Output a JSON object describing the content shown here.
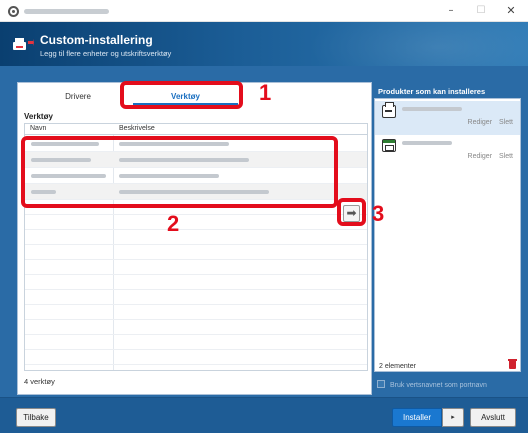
{
  "window": {
    "controls": {
      "minimize": "–",
      "maximize": "☐",
      "close": "✕"
    }
  },
  "header": {
    "title": "Custom-installering",
    "subtitle": "Legg til flere enheter og utskriftsverktøy"
  },
  "tabs": [
    {
      "label": "Drivere",
      "active": false
    },
    {
      "label": "Verktøy",
      "active": true
    }
  ],
  "tools": {
    "section_label": "Verktøy",
    "columns": [
      "Navn",
      "Beskrivelse"
    ],
    "row_count": 4,
    "count_text": "4 verktøy"
  },
  "move_button": {
    "icon": "arrow-right-icon",
    "glyph": "➡"
  },
  "products": {
    "title": "Produkter som kan installeres",
    "items": [
      {
        "icon": "printer-icon",
        "edit": "Rediger",
        "delete": "Slett",
        "selected": true
      },
      {
        "icon": "window-icon",
        "edit": "Rediger",
        "delete": "Slett",
        "selected": false
      }
    ],
    "count_text": "2 elementer"
  },
  "use_hostname_label": "Bruk vertsnavnet som portnavn",
  "footer": {
    "back": "Tilbake",
    "install": "Installer",
    "split_arrow": "▸",
    "close": "Avslutt"
  },
  "annotations": [
    "1",
    "2",
    "3"
  ],
  "colors": {
    "header_dark": "#0a3f70",
    "panel_blue": "#2a6ba6",
    "accent": "#1a6fc0",
    "annotation_red": "#e30d1c"
  }
}
